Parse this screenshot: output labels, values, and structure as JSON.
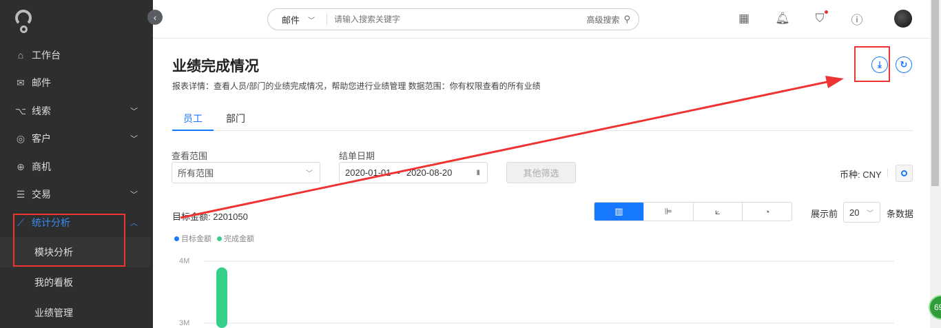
{
  "sidebar": {
    "items": [
      {
        "label": "工作台",
        "icon": "home-icon"
      },
      {
        "label": "邮件",
        "icon": "mail-icon"
      },
      {
        "label": "线索",
        "icon": "leads-icon",
        "expandable": true
      },
      {
        "label": "客户",
        "icon": "customer-icon",
        "expandable": true
      },
      {
        "label": "商机",
        "icon": "target-icon"
      },
      {
        "label": "交易",
        "icon": "document-icon",
        "expandable": true
      },
      {
        "label": "统计分析",
        "icon": "chart-line-icon",
        "expandable": true,
        "active": true
      }
    ],
    "sub_items": [
      {
        "label": "模块分析"
      },
      {
        "label": "我的看板"
      },
      {
        "label": "业绩管理"
      }
    ]
  },
  "header": {
    "search_type": "邮件",
    "search_placeholder": "请输入搜索关键字",
    "advanced_search": "高级搜索"
  },
  "page": {
    "title": "业绩完成情况",
    "description": "报表详情：查看人员/部门的业绩完成情况，帮助您进行业绩管理 数据范围：你有权限查看的所有业绩",
    "tabs": [
      {
        "label": "员工",
        "active": true
      },
      {
        "label": "部门"
      }
    ]
  },
  "filters": {
    "scope_label": "查看范围",
    "scope_value": "所有范围",
    "date_label": "结单日期",
    "date_start": "2020-01-01",
    "date_sep": "-",
    "date_end": "2020-08-20",
    "other_filter": "其他筛选",
    "currency": "币种: CNY"
  },
  "summary": {
    "target_amount": "目标金额: 2201050"
  },
  "display": {
    "prefix": "展示前",
    "count": "20",
    "suffix": "条数据"
  },
  "badge": "69",
  "colors": {
    "accent": "#1677ff",
    "target": "#1677ff",
    "completed": "#36cf8a",
    "sidebar": "#2e2e2e"
  },
  "chart_data": {
    "type": "bar",
    "legend": [
      "目标金额",
      "完成金额"
    ],
    "legend_placement": "top-left",
    "y_ticks": [
      "4M",
      "3M"
    ],
    "series": [
      {
        "name": "完成金额",
        "values": [
          3900000
        ]
      }
    ]
  }
}
